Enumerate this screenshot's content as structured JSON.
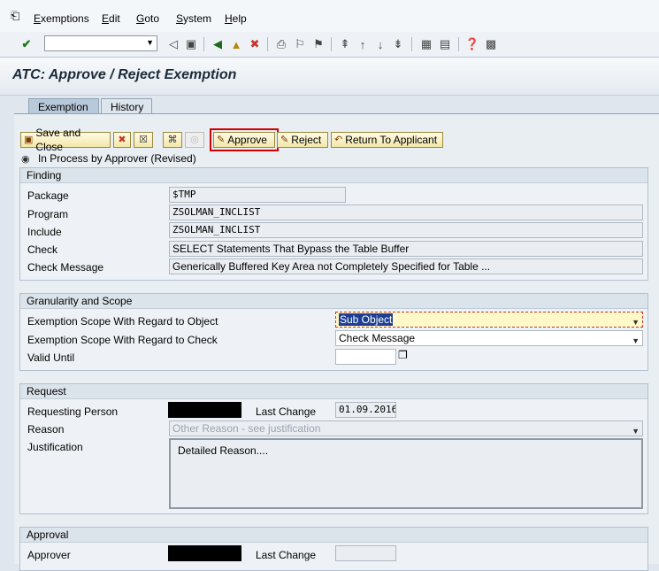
{
  "menu": {
    "items": [
      {
        "label": "Exemptions",
        "u": "E",
        "rest": "xemptions"
      },
      {
        "label": "Edit",
        "u": "E",
        "rest": "dit"
      },
      {
        "label": "Goto",
        "u": "G",
        "rest": "oto"
      },
      {
        "label": "System",
        "u": "S",
        "rest": "ystem"
      },
      {
        "label": "Help",
        "u": "H",
        "rest": "elp"
      }
    ]
  },
  "title": "ATC: Approve / Reject Exemption",
  "tabs": {
    "exemption": "Exemption",
    "history": "History"
  },
  "buttons": {
    "save_close": "Save and Close",
    "approve": "Approve",
    "reject": "Reject",
    "return": "Return To Applicant"
  },
  "status": "In Process by Approver (Revised)",
  "finding": {
    "title": "Finding",
    "package_label": "Package",
    "package_value": "$TMP",
    "program_label": "Program",
    "program_value": "ZSOLMAN_INCLIST",
    "include_label": "Include",
    "include_value": "ZSOLMAN_INCLIST",
    "check_label": "Check",
    "check_value": "SELECT Statements That Bypass the Table Buffer",
    "msg_label": "Check Message",
    "msg_value": "Generically Buffered Key Area not Completely Specified for Table ..."
  },
  "granularity": {
    "title": "Granularity and Scope",
    "obj_label": "Exemption Scope With Regard to Object",
    "obj_value": "Sub Object",
    "chk_label": "Exemption Scope With Regard to Check",
    "chk_value": "Check Message",
    "valid_label": "Valid Until",
    "valid_value": ""
  },
  "request": {
    "title": "Request",
    "person_label": "Requesting Person",
    "last_change_label": "Last Change",
    "last_change_value": "01.09.2016",
    "reason_label": "Reason",
    "reason_value": "Other Reason - see justification",
    "justification_label": "Justification",
    "justification_value": "Detailed Reason...."
  },
  "approval": {
    "title": "Approval",
    "approver_label": "Approver",
    "last_change_label": "Last Change",
    "last_change_value": ""
  }
}
